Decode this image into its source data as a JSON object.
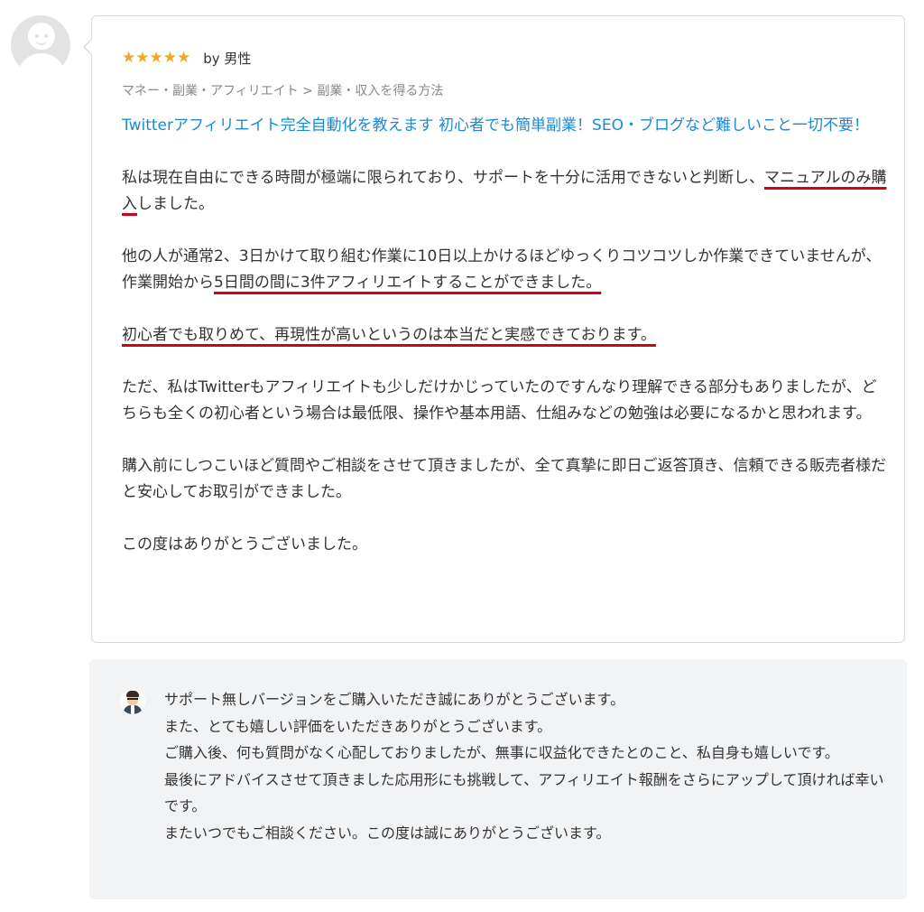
{
  "review": {
    "stars": "★★★★★",
    "rating": 5,
    "star_color": "#f5a623",
    "author": "by 男性",
    "category": "マネー・副業・アフィリエイト > 副業・収入を得る方法",
    "service_title": "Twitterアフィリエイト完全自動化を教えます 初心者でも簡単副業！SEO・ブログなど難しいこと一切不要！",
    "link_color": "#1a8ad4",
    "p1_a": "私は現在自由にできる時間が極端に限られており、サポートを十分に活用できないと判断し、",
    "p1_b": "マニュアルのみ購入",
    "p1_c": "しました。",
    "p2_a": "他の人が通常2、3日かけて取り組む作業に10日以上かけるほどゆっくりコツコツしか作業できていませんが、作業開始から",
    "p2_b": "5日間の間に3件アフィリエイトすることができました。",
    "p3": "初心者でも取りめて、再現性が高いというのは本当だと実感できております。",
    "p4": "ただ、私はTwitterもアフィリエイトも少しだけかじっていたのですんなり理解できる部分もありましたが、どちらも全くの初心者という場合は最低限、操作や基本用語、仕組みなどの勉強は必要になるかと思われます。",
    "p5": "購入前にしつこいほど質問やご相談をさせて頂きましたが、全て真摯に即日ご返答頂き、信頼できる販売者様だと安心してお取引ができました。",
    "p6": "この度はありがとうございました。",
    "underline_color": "#d0021b"
  },
  "reply": {
    "line1": "サポート無しバージョンをご購入いただき誠にありがとうございます。",
    "line2": "また、とても嬉しい評価をいただきありがとうございます。",
    "line3": "ご購入後、何も質問がなく心配しておりましたが、無事に収益化できたとのこと、私自身も嬉しいです。",
    "line4": "最後にアドバイスさせて頂きました応用形にも挑戦して、アフィリエイト報酬をさらにアップして頂ければ幸いです。",
    "line5": "またいつでもご相談ください。この度は誠にありがとうございます。",
    "background": "#f2f3f5"
  },
  "icons": {
    "reviewer_avatar": "default-user-avatar-icon",
    "seller_avatar": "seller-avatar-icon"
  }
}
